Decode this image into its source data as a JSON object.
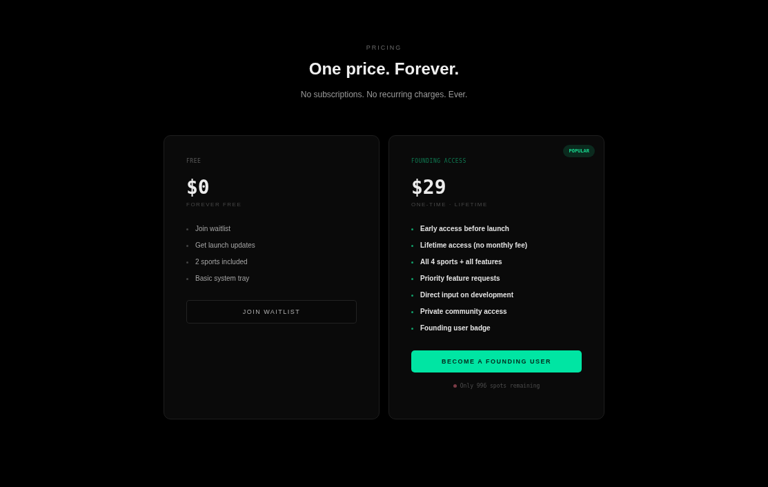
{
  "header": {
    "eyebrow": "PRICING",
    "title": "One price. Forever.",
    "subtitle": "No subscriptions. No recurring charges. Ever."
  },
  "plans": [
    {
      "kind": "free",
      "name": "FREE",
      "price": "$0",
      "term": "FOREVER FREE",
      "features": [
        "Join waitlist",
        "Get launch updates",
        "2 sports included",
        "Basic system tray"
      ],
      "button": "JOIN WAITLIST"
    },
    {
      "kind": "featured",
      "badge": "POPULAR",
      "name": "FOUNDING ACCESS",
      "price": "$29",
      "term": "ONE-TIME · LIFETIME",
      "features": [
        "Early access before launch",
        "Lifetime access (no monthly fee)",
        "All 4 sports + all features",
        "Priority feature requests",
        "Direct input on development",
        "Private community access",
        "Founding user badge"
      ],
      "button": "BECOME A FOUNDING USER",
      "note": "Only 996 spots remaining"
    }
  ]
}
